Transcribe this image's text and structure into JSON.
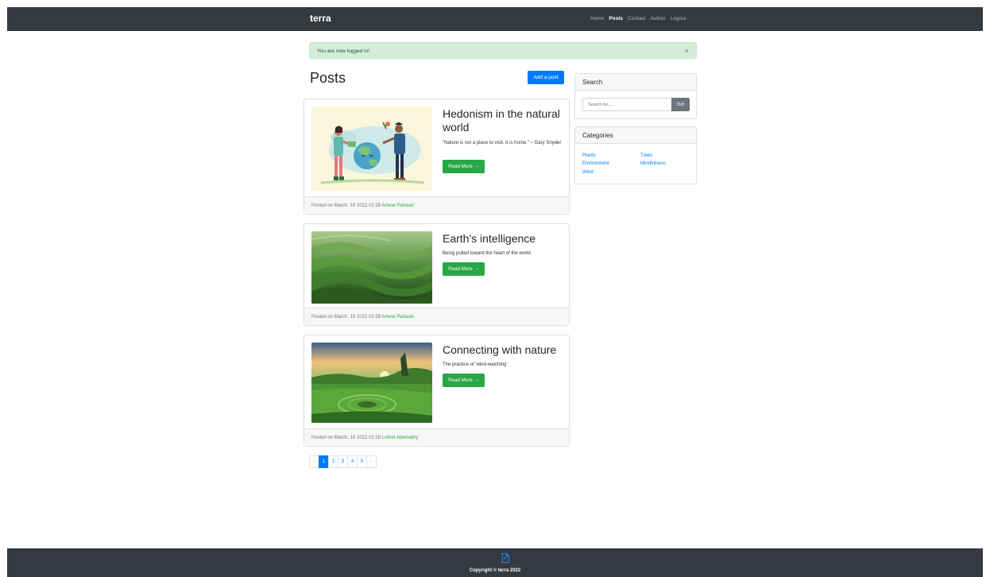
{
  "navbar": {
    "brand": "terra",
    "links": [
      "Home",
      "Posts",
      "Contact",
      "Author",
      "Logout"
    ],
    "active": "Posts"
  },
  "alert": {
    "message": "You are now logged in!",
    "close": "×"
  },
  "page": {
    "title": "Posts",
    "add_button": "Add a post"
  },
  "posts": [
    {
      "title": "Hedonism in the natural world",
      "excerpt": "\"Nature is not a place to visit. It is home.\" – Gary Snyder",
      "read_more": "Read More →",
      "posted_prefix": "Posted on March. 10 2022 02:28",
      "author": "Arlene Parisian",
      "image": "illustration-people-watering-earth"
    },
    {
      "title": "Earth's intelligence",
      "excerpt": "Being pulled toward the heart of the world",
      "read_more": "Read More →",
      "posted_prefix": "Posted on March. 10 2022 02:28",
      "author": "Arlene Parisian",
      "image": "photo-green-terraced-hills"
    },
    {
      "title": "Connecting with nature",
      "excerpt": "The practice of 'wind-watching'",
      "read_more": "Read More →",
      "posted_prefix": "Posted on March. 10 2022 02:28",
      "author": "Luther Abernathy",
      "image": "photo-green-landscape-sunset"
    }
  ],
  "pagination": {
    "prev": "‹",
    "pages": [
      "1",
      "2",
      "3",
      "4",
      "5"
    ],
    "next": "›",
    "active": "1"
  },
  "search": {
    "title": "Search",
    "placeholder": "Search for...",
    "button": "Go!"
  },
  "categories": {
    "title": "Categories",
    "items": [
      "Plants",
      "Trees",
      "Environment",
      "Mindfulness",
      "Wind"
    ]
  },
  "footer": {
    "icon": "file-icon",
    "text": "Copyright © terra 2022"
  },
  "colors": {
    "navbar": "#343a40",
    "primary": "#007bff",
    "success": "#28a745",
    "alert_bg": "#d4edda"
  }
}
